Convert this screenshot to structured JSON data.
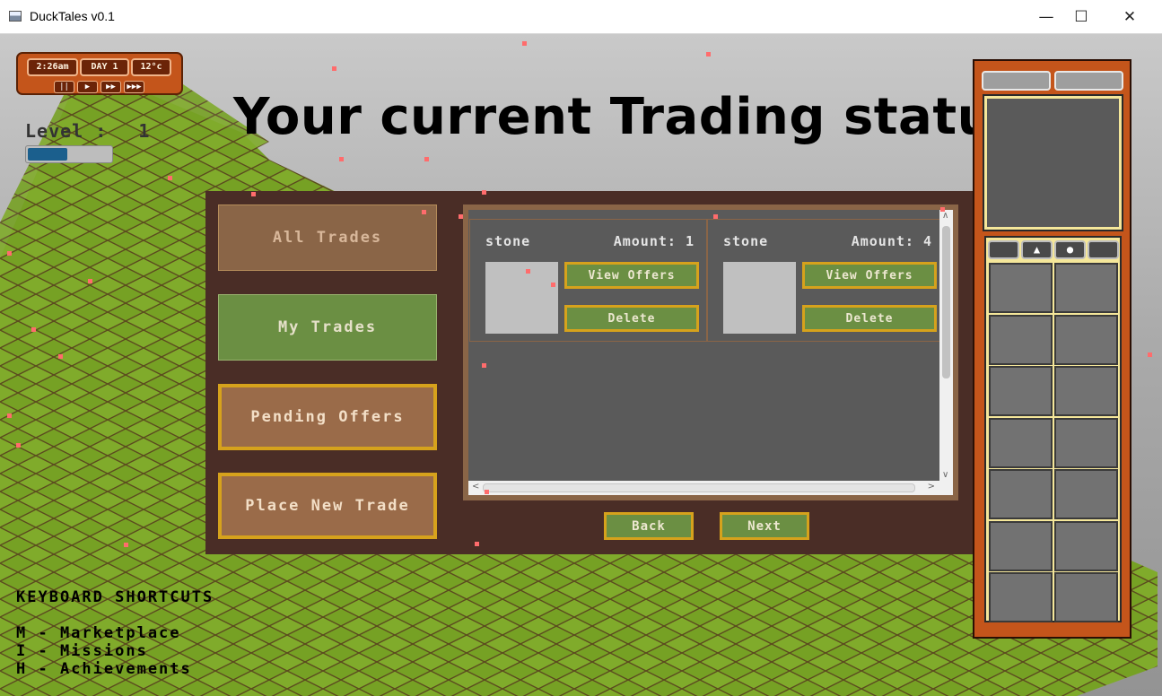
{
  "window": {
    "title": "DuckTales v0.1",
    "minimize_icon": "minimize-icon",
    "maximize_icon": "maximize-icon",
    "close_icon": "close-icon"
  },
  "hud": {
    "time": "2:26am",
    "day": "DAY 1",
    "temperature": "12°c",
    "controls": [
      {
        "name": "pause-icon",
        "glyph": "⏸"
      },
      {
        "name": "play-icon",
        "glyph": "▶"
      },
      {
        "name": "fast-forward-icon",
        "glyph": "⏩"
      },
      {
        "name": "fastest-forward-icon",
        "glyph": "⏭"
      }
    ],
    "level_label": "Level :",
    "level_value": "1",
    "level_progress": 0.47
  },
  "title": "Your current Trading status",
  "menu": {
    "all_trades": "All Trades",
    "my_trades": "My Trades",
    "pending_offers": "Pending Offers",
    "place_new_trade": "Place New Trade"
  },
  "trades": [
    {
      "item": "stone",
      "amount": "Amount: 1",
      "view_label": "View Offers",
      "delete_label": "Delete"
    },
    {
      "item": "stone",
      "amount": "Amount: 4",
      "view_label": "View Offers",
      "delete_label": "Delete"
    }
  ],
  "navigation": {
    "back": "Back",
    "next": "Next"
  },
  "shortcuts": {
    "title": "KEYBOARD SHORTCUTS",
    "items": [
      "M - Marketplace",
      "I - Missions",
      "H - Achievements"
    ]
  },
  "inventory": {
    "tab_icons": [
      "",
      "house-icon",
      "duck-icon",
      ""
    ],
    "slots": 14
  },
  "colors": {
    "panel": "#4a2d26",
    "button_green": "#6b8f43",
    "button_border_gold": "#d6a21c",
    "orange_frame": "#c4551b",
    "grass": "#7ea92a"
  }
}
